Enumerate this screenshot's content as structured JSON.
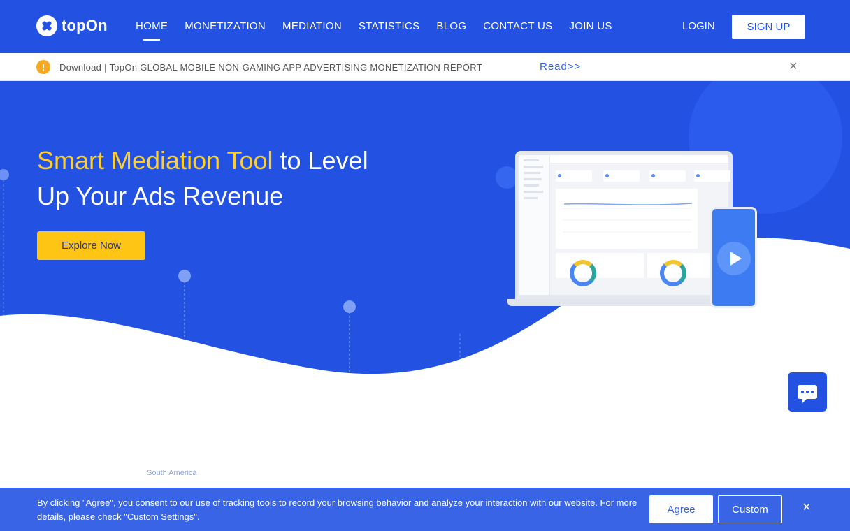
{
  "header": {
    "logo_text": "topOn",
    "nav": [
      {
        "label": "HOME",
        "active": true
      },
      {
        "label": "MONETIZATION"
      },
      {
        "label": "MEDIATION"
      },
      {
        "label": "STATISTICS"
      },
      {
        "label": "BLOG"
      },
      {
        "label": "CONTACT US"
      },
      {
        "label": "JOIN US"
      }
    ],
    "login": "LOGIN",
    "signup": "SIGN UP"
  },
  "notice": {
    "icon": "!",
    "text": "Download | TopOn GLOBAL MOBILE NON-GAMING APP ADVERTISING MONETIZATION REPORT",
    "link": "Read>>",
    "close": "×"
  },
  "hero": {
    "title_highlight": "Smart Mediation Tool",
    "title_rest_1": " to Level",
    "title_line_2": "Up Your Ads Revenue",
    "cta": "Explore Now"
  },
  "map": {
    "label": "South America"
  },
  "cookie": {
    "text": "By clicking \"Agree\", you consent to our use of tracking tools to record your browsing behavior and analyze your interaction with our website. For more details, please check \"Custom Settings\".",
    "agree": "Agree",
    "custom": "Custom",
    "close": "×"
  },
  "colors": {
    "brand_blue": "#2352e3",
    "accent_yellow": "#ffc514",
    "highlight_yellow": "#ffcd2e"
  }
}
